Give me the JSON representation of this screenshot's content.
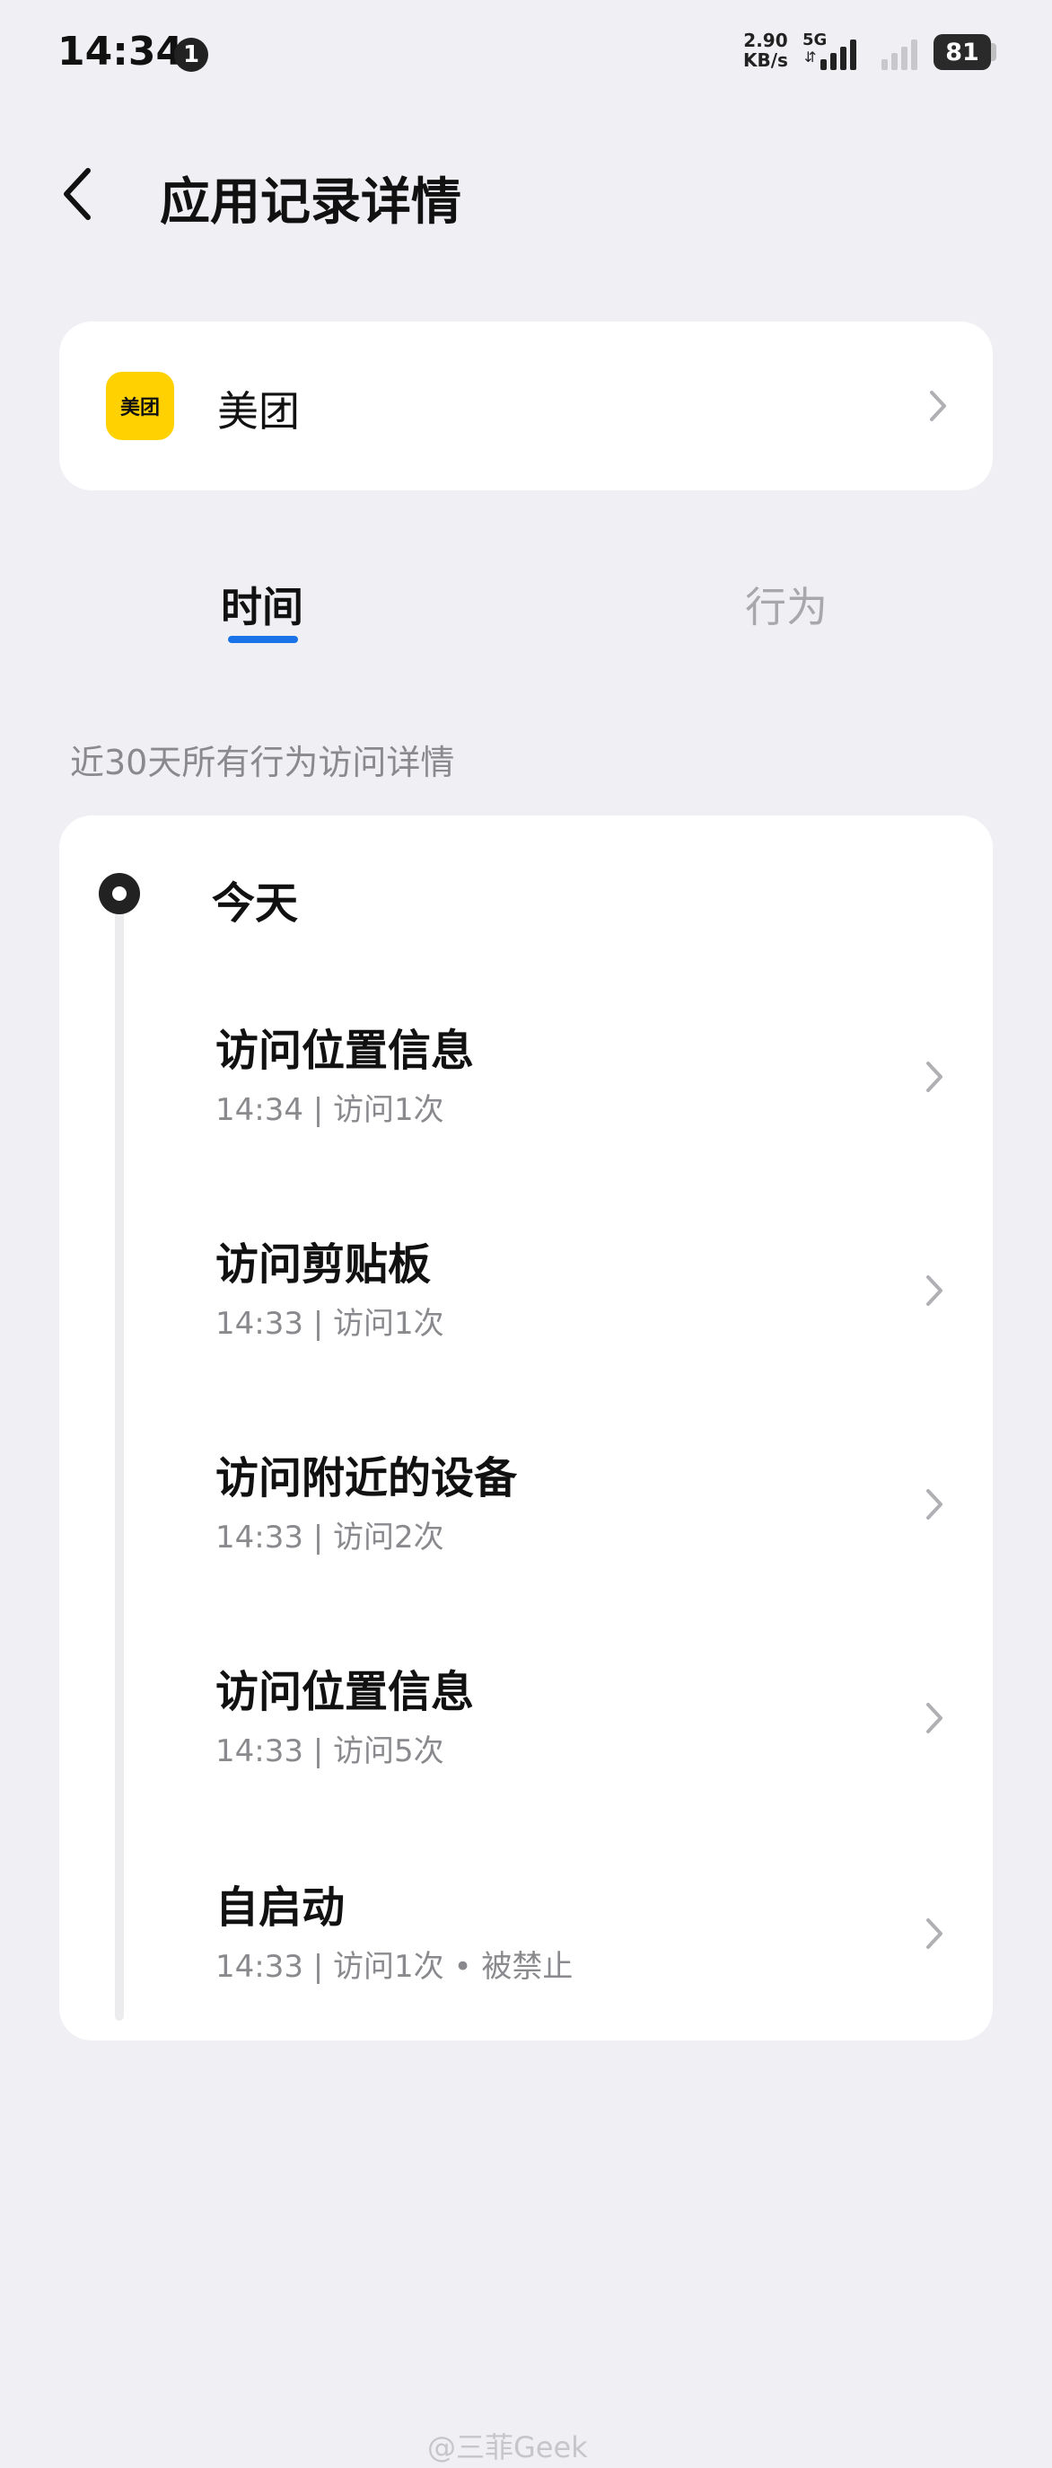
{
  "status_bar": {
    "time": "14:34",
    "notification_count": "1",
    "net_speed_value": "2.90",
    "net_speed_unit": "KB/s",
    "network_type": "5G",
    "battery": "81"
  },
  "header": {
    "title": "应用记录详情"
  },
  "app": {
    "icon_text": "美团",
    "name": "美团",
    "icon_color": "#ffd100"
  },
  "tabs": [
    {
      "label": "时间",
      "active": true
    },
    {
      "label": "行为",
      "active": false
    }
  ],
  "accent_color": "#1a73e8",
  "section_label": "近30天所有行为访问详情",
  "timeline": {
    "day": "今天",
    "records": [
      {
        "title": "访问位置信息",
        "meta": "14:34 | 访问1次"
      },
      {
        "title": "访问剪贴板",
        "meta": "14:33 | 访问1次"
      },
      {
        "title": "访问附近的设备",
        "meta": "14:33 | 访问2次"
      },
      {
        "title": "访问位置信息",
        "meta": "14:33 | 访问5次"
      },
      {
        "title": "自启动",
        "meta": "14:33 | 访问1次 • 被禁止"
      }
    ]
  },
  "watermark": "@三菲Geek"
}
